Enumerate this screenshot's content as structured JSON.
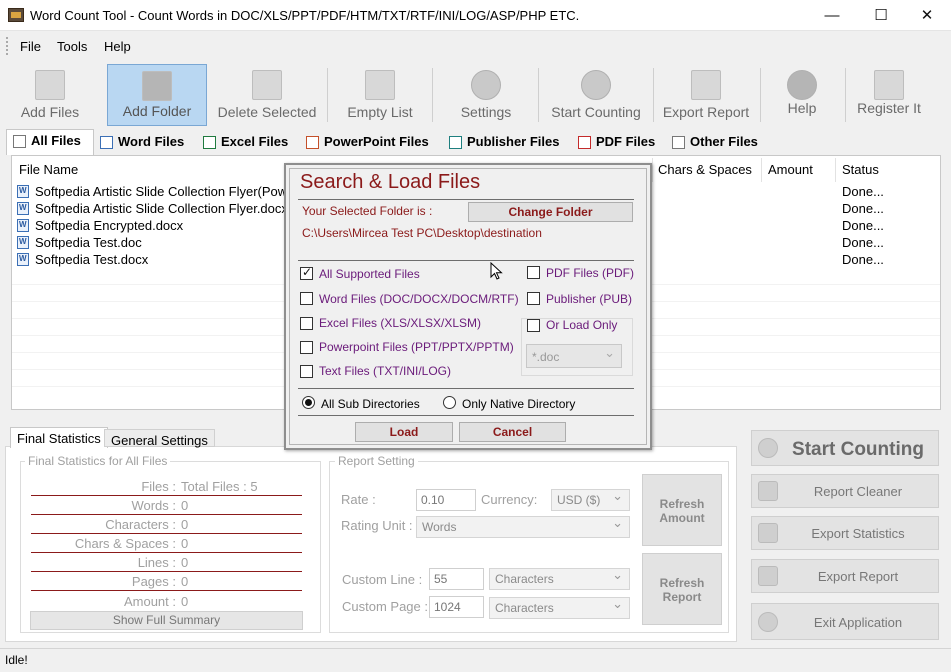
{
  "window": {
    "title": "Word Count Tool - Count Words in DOC/XLS/PPT/PDF/HTM/TXT/RTF/INI/LOG/ASP/PHP ETC.",
    "minimize": "—",
    "maximize": "☐",
    "close": "✕"
  },
  "menu": [
    "File",
    "Tools",
    "Help"
  ],
  "toolbar": {
    "add_files": "Add Files",
    "add_folder": "Add Folder",
    "delete_selected": "Delete Selected",
    "empty_list": "Empty List",
    "settings": "Settings",
    "start_counting": "Start Counting",
    "export_report": "Export Report",
    "help": "Help",
    "register": "Register It"
  },
  "file_tabs": [
    "All Files",
    "Word Files",
    "Excel Files",
    "PowerPoint Files",
    "Publisher Files",
    "PDF Files",
    "Other Files"
  ],
  "grid": {
    "columns": [
      "File Name",
      "Chars & Spaces",
      "Amount",
      "Status"
    ],
    "rows": [
      {
        "name": "Softpedia Artistic Slide Collection Flyer(Pow",
        "status": "Done..."
      },
      {
        "name": "Softpedia Artistic Slide Collection Flyer.docx",
        "status": "Done..."
      },
      {
        "name": "Softpedia Encrypted.docx",
        "status": "Done..."
      },
      {
        "name": "Softpedia Test.doc",
        "status": "Done..."
      },
      {
        "name": "Softpedia Test.docx",
        "status": "Done..."
      }
    ]
  },
  "bottom_tabs": [
    "Final Statistics",
    "General Settings"
  ],
  "final_stats": {
    "group_title": "Final Statistics for All Files",
    "items": [
      {
        "key": "Files :",
        "value": "Total Files : 5"
      },
      {
        "key": "Words :",
        "value": "0"
      },
      {
        "key": "Characters :",
        "value": "0"
      },
      {
        "key": "Chars & Spaces :",
        "value": "0"
      },
      {
        "key": "Lines :",
        "value": "0"
      },
      {
        "key": "Pages :",
        "value": "0"
      },
      {
        "key": "Amount :",
        "value": "0"
      }
    ],
    "show_summary": "Show Full Summary"
  },
  "report_setting": {
    "group_title": "Report Setting",
    "rate_label": "Rate :",
    "rate_value": "0.10",
    "currency_label": "Currency:",
    "currency_value": "USD ($)",
    "rating_unit_label": "Rating Unit :",
    "rating_unit_value": "Words",
    "refresh_amount": "Refresh Amount",
    "custom_line_label": "Custom Line :",
    "custom_line_value": "55",
    "custom_line_unit": "Characters",
    "custom_page_label": "Custom Page :",
    "custom_page_value": "1024",
    "custom_page_unit": "Characters",
    "refresh_report": "Refresh Report"
  },
  "actions": {
    "start_counting": "Start Counting",
    "report_cleaner": "Report Cleaner",
    "export_statistics": "Export Statistics",
    "export_report": "Export Report",
    "exit": "Exit Application"
  },
  "status": "Idle!",
  "dialog": {
    "title": "Search & Load Files",
    "selected_folder_label": "Your Selected Folder is :",
    "change_folder": "Change Folder",
    "path": "C:\\Users\\Mircea Test PC\\Desktop\\destination",
    "options_left": [
      {
        "label": "All Supported Files",
        "checked": true
      },
      {
        "label": "Word Files (DOC/DOCX/DOCM/RTF)",
        "checked": false
      },
      {
        "label": "Excel Files (XLS/XLSX/XLSM)",
        "checked": false
      },
      {
        "label": "Powerpoint Files (PPT/PPTX/PPTM)",
        "checked": false
      },
      {
        "label": "Text Files (TXT/INI/LOG)",
        "checked": false
      }
    ],
    "options_right": [
      {
        "label": "PDF Files (PDF)",
        "checked": false
      },
      {
        "label": "Publisher (PUB)",
        "checked": false
      },
      {
        "label": "Or Load Only",
        "checked": false
      }
    ],
    "ext_value": "*.doc",
    "radio_all": "All Sub Directories",
    "radio_native": "Only Native Directory",
    "load": "Load",
    "cancel": "Cancel"
  }
}
